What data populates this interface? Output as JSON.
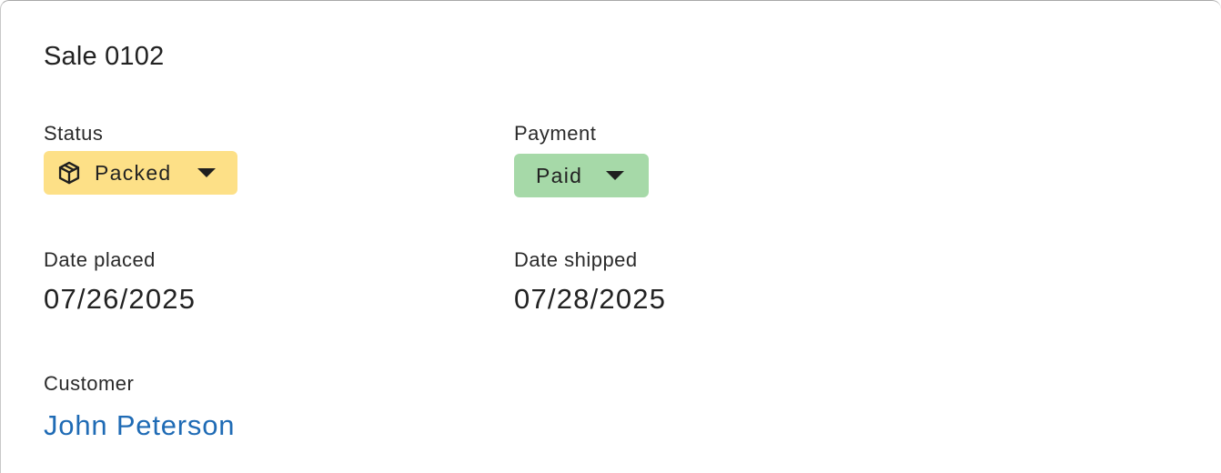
{
  "header": {
    "title": "Sale 0102"
  },
  "status": {
    "label": "Status",
    "value": "Packed",
    "icon": "package-icon",
    "color": "#fde087"
  },
  "payment": {
    "label": "Payment",
    "value": "Paid",
    "color": "#a6d9a8"
  },
  "date_placed": {
    "label": "Date placed",
    "value": "07/26/2025"
  },
  "date_shipped": {
    "label": "Date shipped",
    "value": "07/28/2025"
  },
  "customer": {
    "label": "Customer",
    "name": "John Peterson",
    "link_color": "#1f6bb5"
  }
}
